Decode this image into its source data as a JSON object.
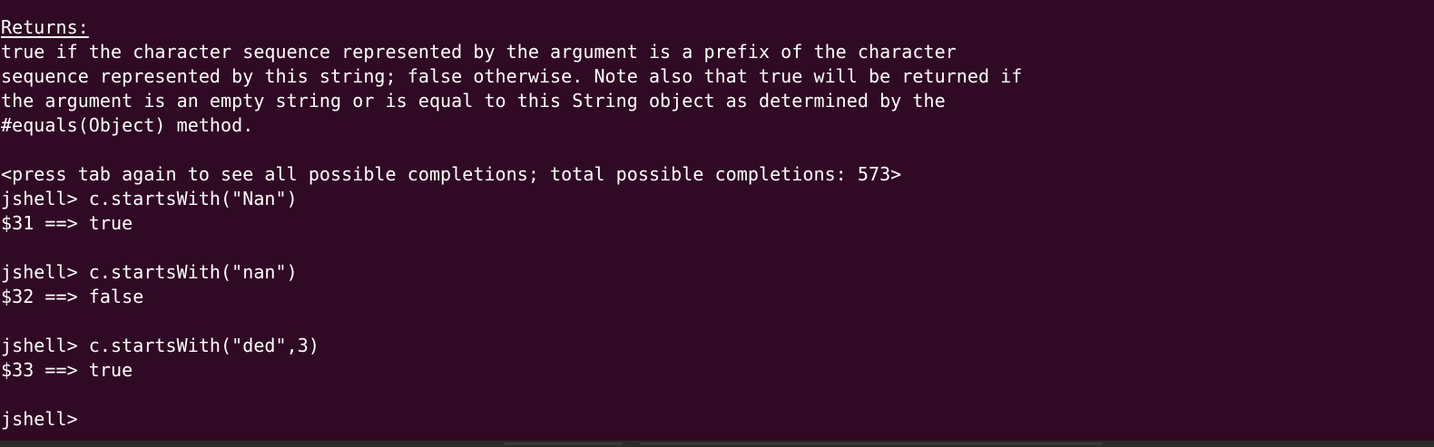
{
  "terminal": {
    "lines": [
      "Returns:",
      "true if the character sequence represented by the argument is a prefix of the character",
      "sequence represented by this string; false otherwise. Note also that true will be returned if",
      "the argument is an empty string or is equal to this String object as determined by the",
      "#equals(Object) method.",
      "",
      "<press tab again to see all possible completions; total possible completions: 573>",
      "jshell> c.startsWith(\"Nan\")",
      "$31 ==> true",
      "",
      "jshell> c.startsWith(\"nan\")",
      "$32 ==> false",
      "",
      "jshell> c.startsWith(\"ded\",3)",
      "$33 ==> true",
      "",
      "jshell> "
    ]
  },
  "colors": {
    "background": "#300a24",
    "foreground": "#ffffff"
  }
}
